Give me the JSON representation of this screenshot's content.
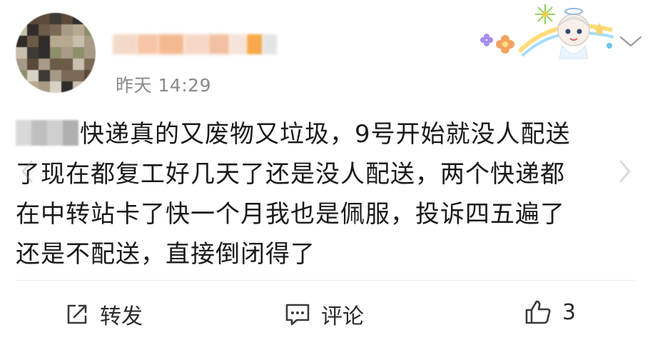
{
  "post": {
    "timestamp": "昨天 14:29",
    "content_line1": "快递真的又废物又垃圾，9号开始就没人配送",
    "content_line2": "了现在都复工好几天了还是没人配送，两个快递都",
    "content_line3": "在中转站卡了快一个月我也是佩服，投诉四五遍了",
    "content_line4": "还是不配送，直接倒闭得了"
  },
  "actions": {
    "repost_label": "转发",
    "comment_label": "评论",
    "like_count": "3"
  },
  "icons": {
    "repost": "share-icon",
    "comment": "comment-icon",
    "like": "thumbs-up-icon",
    "expand": "chevron-down-icon"
  },
  "colors": {
    "text": "#1a1a1a",
    "meta": "#8a8a8a",
    "divider": "#ececec"
  }
}
